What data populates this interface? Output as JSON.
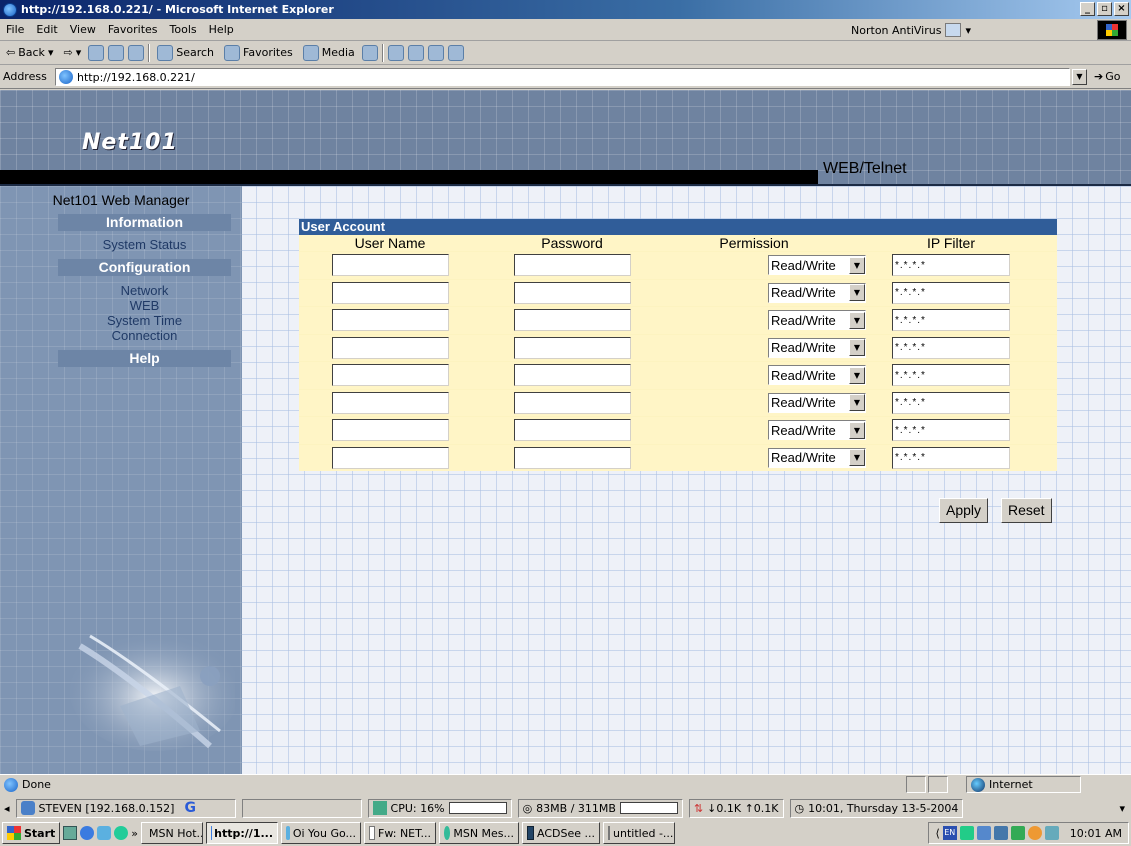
{
  "window": {
    "title": "http://192.168.0.221/ - Microsoft Internet Explorer"
  },
  "menubar": {
    "items": [
      "File",
      "Edit",
      "View",
      "Favorites",
      "Tools",
      "Help"
    ],
    "norton": "Norton AntiVirus"
  },
  "toolbar": {
    "back": "Back",
    "search": "Search",
    "favorites": "Favorites",
    "media": "Media"
  },
  "address": {
    "label": "Address",
    "url": "http://192.168.0.221/",
    "go": "Go"
  },
  "banner": {
    "logo": "Net101",
    "section": "WEB/Telnet"
  },
  "sidebar": {
    "title": "Net101 Web Manager",
    "information": "Information",
    "system_status": "System Status",
    "configuration": "Configuration",
    "network": "Network",
    "web": "WEB",
    "system_time": "System Time",
    "connection": "Connection",
    "help": "Help"
  },
  "user_account": {
    "title": "User Account",
    "columns": [
      "User Name",
      "Password",
      "Permission",
      "IP Filter"
    ],
    "rows": [
      {
        "user": "",
        "password": "",
        "permission": "Read/Write",
        "ip": "*.*.*.*"
      },
      {
        "user": "",
        "password": "",
        "permission": "Read/Write",
        "ip": "*.*.*.*"
      },
      {
        "user": "",
        "password": "",
        "permission": "Read/Write",
        "ip": "*.*.*.*"
      },
      {
        "user": "",
        "password": "",
        "permission": "Read/Write",
        "ip": "*.*.*.*"
      },
      {
        "user": "",
        "password": "",
        "permission": "Read/Write",
        "ip": "*.*.*.*"
      },
      {
        "user": "",
        "password": "",
        "permission": "Read/Write",
        "ip": "*.*.*.*"
      },
      {
        "user": "",
        "password": "",
        "permission": "Read/Write",
        "ip": "*.*.*.*"
      },
      {
        "user": "",
        "password": "",
        "permission": "Read/Write",
        "ip": "*.*.*.*"
      }
    ],
    "apply": "Apply",
    "reset": "Reset"
  },
  "status": {
    "text": "Done",
    "zone": "Internet"
  },
  "infobar": {
    "host": "STEVEN [192.168.0.152]",
    "cpu": "CPU: 16%",
    "memory": "83MB / 311MB",
    "net": "↓0.1K  ↑0.1K",
    "datetime": "10:01, Thursday 13-5-2004"
  },
  "taskbar": {
    "start": "Start",
    "tasks": [
      "MSN Hot...",
      "http://1...",
      "Oi You Go...",
      "Fw: NET...",
      "MSN Mes...",
      "ACDSee ...",
      "untitled -..."
    ],
    "clock": "10:01 AM"
  }
}
